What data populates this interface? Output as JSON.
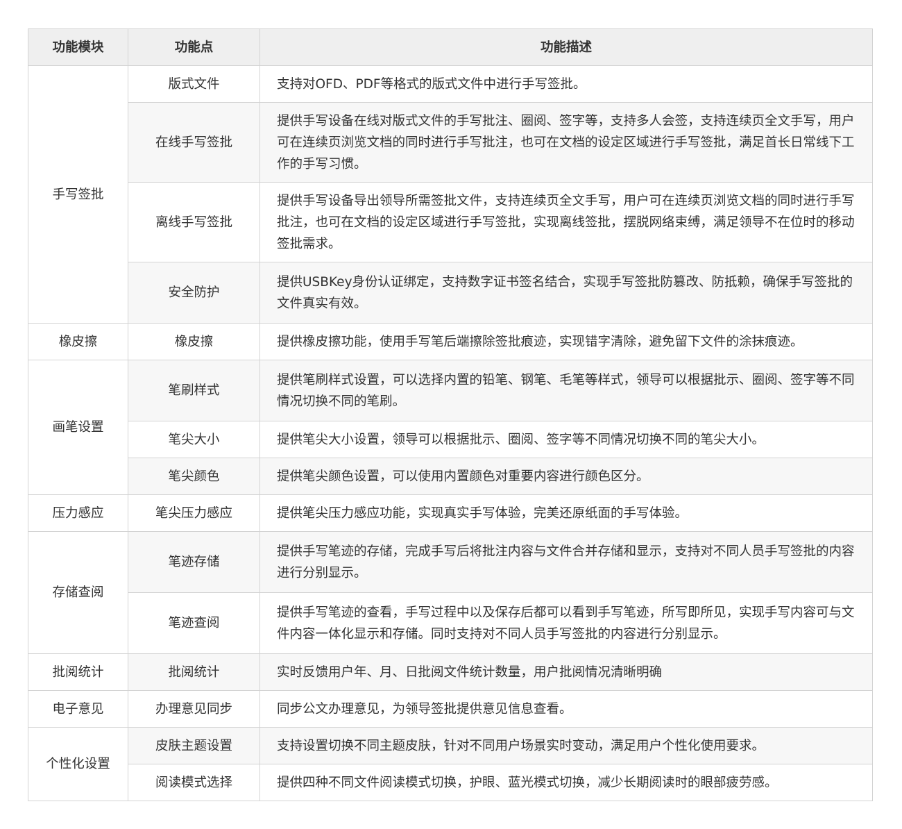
{
  "table": {
    "headers": [
      "功能模块",
      "功能点",
      "功能描述"
    ],
    "groups": [
      {
        "module": "手写签批",
        "rows": [
          {
            "point": "版式文件",
            "desc": "支持对OFD、PDF等格式的版式文件中进行手写签批。"
          },
          {
            "point": "在线手写签批",
            "desc": "提供手写设备在线对版式文件的手写批注、圈阅、签字等，支持多人会签，支持连续页全文手写，用户可在连续页浏览文档的同时进行手写批注，也可在文档的设定区域进行手写签批，满足首长日常线下工作的手写习惯。"
          },
          {
            "point": "离线手写签批",
            "desc": "提供手写设备导出领导所需签批文件，支持连续页全文手写，用户可在连续页浏览文档的同时进行手写批注，也可在文档的设定区域进行手写签批，实现离线签批，摆脱网络束缚，满足领导不在位时的移动签批需求。"
          },
          {
            "point": "安全防护",
            "desc": "提供USBKey身份认证绑定，支持数字证书签名结合，实现手写签批防篡改、防抵赖，确保手写签批的文件真实有效。"
          }
        ]
      },
      {
        "module": "橡皮擦",
        "rows": [
          {
            "point": "橡皮擦",
            "desc": "提供橡皮擦功能，使用手写笔后端擦除签批痕迹，实现错字清除，避免留下文件的涂抹痕迹。"
          }
        ]
      },
      {
        "module": "画笔设置",
        "rows": [
          {
            "point": "笔刷样式",
            "desc": "提供笔刷样式设置，可以选择内置的铅笔、钢笔、毛笔等样式，领导可以根据批示、圈阅、签字等不同情况切换不同的笔刷。"
          },
          {
            "point": "笔尖大小",
            "desc": "提供笔尖大小设置，领导可以根据批示、圈阅、签字等不同情况切换不同的笔尖大小。"
          },
          {
            "point": "笔尖颜色",
            "desc": "提供笔尖颜色设置，可以使用内置颜色对重要内容进行颜色区分。"
          }
        ]
      },
      {
        "module": "压力感应",
        "rows": [
          {
            "point": "笔尖压力感应",
            "desc": "提供笔尖压力感应功能，实现真实手写体验，完美还原纸面的手写体验。"
          }
        ]
      },
      {
        "module": "存储查阅",
        "rows": [
          {
            "point": "笔迹存储",
            "desc": "提供手写笔迹的存储，完成手写后将批注内容与文件合并存储和显示，支持对不同人员手写签批的内容进行分别显示。"
          },
          {
            "point": "笔迹查阅",
            "desc": "提供手写笔迹的查看，手写过程中以及保存后都可以看到手写笔迹，所写即所见，实现手写内容可与文件内容一体化显示和存储。同时支持对不同人员手写签批的内容进行分别显示。"
          }
        ]
      },
      {
        "module": "批阅统计",
        "rows": [
          {
            "point": "批阅统计",
            "desc": "实时反馈用户年、月、日批阅文件统计数量，用户批阅情况清晰明确"
          }
        ]
      },
      {
        "module": "电子意见",
        "rows": [
          {
            "point": "办理意见同步",
            "desc": "同步公文办理意见，为领导签批提供意见信息查看。"
          }
        ]
      },
      {
        "module": "个性化设置",
        "rows": [
          {
            "point": "皮肤主题设置",
            "desc": "支持设置切换不同主题皮肤，针对不同用户场景实时变动，满足用户个性化使用要求。"
          },
          {
            "point": "阅读模式选择",
            "desc": "提供四种不同文件阅读模式切换，护眼、蓝光模式切换，减少长期阅读时的眼部疲劳感。"
          }
        ]
      }
    ]
  }
}
